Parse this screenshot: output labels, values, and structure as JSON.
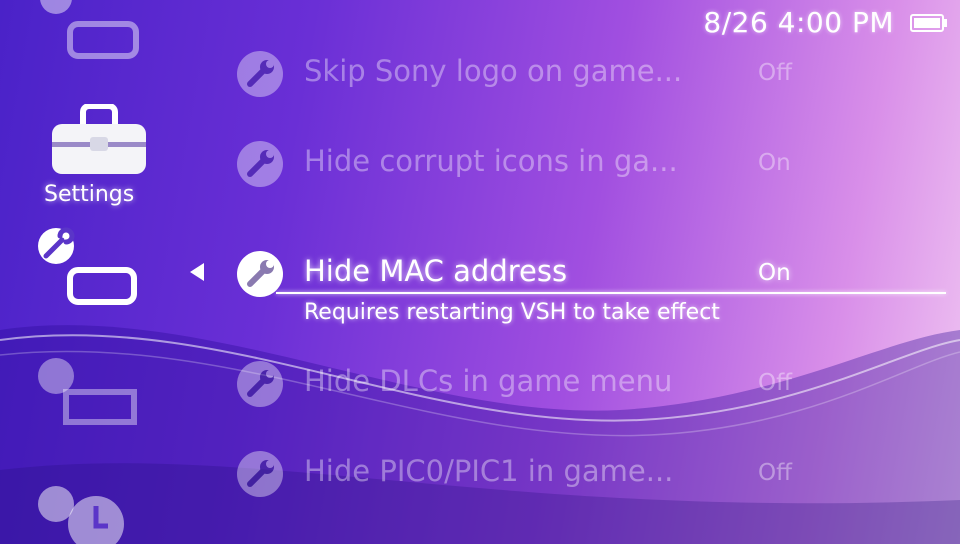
{
  "status": {
    "clock": "8/26 4:00 PM",
    "battery_icon": "battery-icon"
  },
  "category": {
    "label": "Settings",
    "icon": "toolbox-icon"
  },
  "menu": {
    "items": [
      {
        "label": "Skip Sony logo on game...",
        "value": "Off",
        "icon": "wrench-icon"
      },
      {
        "label": "Hide corrupt icons in ga...",
        "value": "On",
        "icon": "wrench-icon"
      },
      {
        "label": "Hide MAC address",
        "value": "On",
        "icon": "wrench-icon",
        "selected": true
      },
      {
        "label": "Hide DLCs in game menu",
        "value": "Off",
        "icon": "wrench-icon"
      },
      {
        "label": "Hide PIC0/PIC1 in game...",
        "value": "Off",
        "icon": "wrench-icon"
      }
    ],
    "description": "Requires restarting VSH to take effect"
  },
  "colors": {
    "background_start": "#4a22c8",
    "background_end": "#f0c6f2",
    "text": "#ffffff"
  }
}
